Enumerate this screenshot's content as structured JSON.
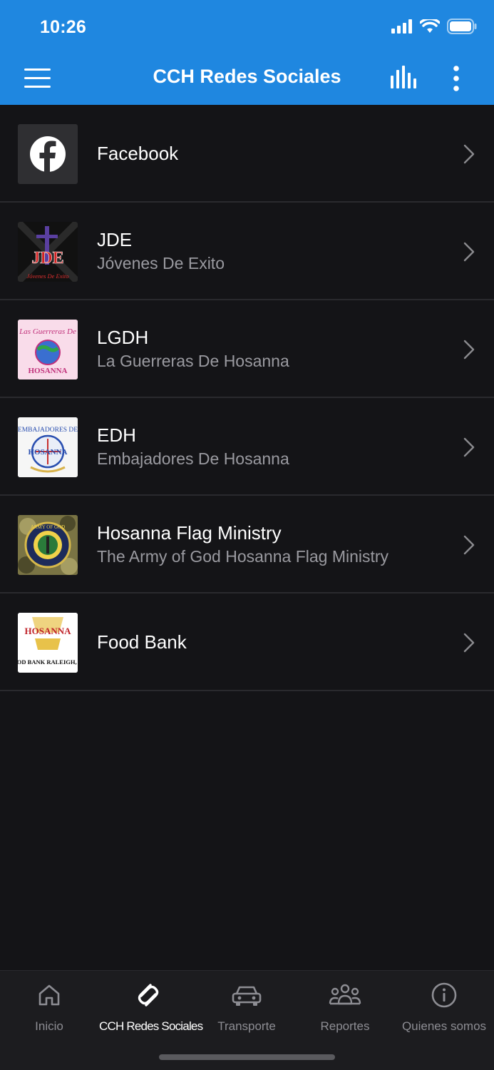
{
  "status_bar": {
    "time": "10:26"
  },
  "header": {
    "title": "CCH Redes Sociales",
    "menu_icon": "hamburger-icon",
    "stats_icon": "bar-chart-icon",
    "more_icon": "more-vertical-icon"
  },
  "colors": {
    "header": "#1f87e0",
    "background": "#141417",
    "subtitle": "#9a9aa0",
    "tab_inactive": "#8d8d93"
  },
  "items": [
    {
      "title": "Facebook",
      "subtitle": "",
      "icon": "facebook-logo"
    },
    {
      "title": "JDE",
      "subtitle": "Jóvenes De Exito",
      "icon": "jde-logo",
      "logo_text": "JDE",
      "logo_caption": "Jóvenes De Exito"
    },
    {
      "title": "LGDH",
      "subtitle": "La Guerreras De Hosanna",
      "icon": "lgdh-logo",
      "logo_text": "Las Guerreras De",
      "logo_caption": "HOSANNA"
    },
    {
      "title": "EDH",
      "subtitle": "Embajadores De Hosanna",
      "icon": "edh-logo",
      "logo_text": "EMBAJADORES DE",
      "logo_caption": "HOSANNA"
    },
    {
      "title": "Hosanna Flag Ministry",
      "subtitle": "The Army of God Hosanna Flag Ministry",
      "icon": "flag-ministry-logo",
      "logo_text": "ARMY OF GOD"
    },
    {
      "title": "Food Bank",
      "subtitle": "",
      "icon": "food-bank-logo",
      "logo_text": "HOSANNA",
      "logo_caption": "FOOD BANK RALEIGH, NC"
    }
  ],
  "tabs": [
    {
      "label": "Inicio",
      "icon": "home-icon",
      "active": false
    },
    {
      "label": "CCH Redes Sociales",
      "icon": "social-links-icon",
      "active": true
    },
    {
      "label": "Transporte",
      "icon": "car-icon",
      "active": false
    },
    {
      "label": "Reportes",
      "icon": "people-group-icon",
      "active": false
    },
    {
      "label": "Quienes somos",
      "icon": "info-circle-icon",
      "active": false
    }
  ]
}
